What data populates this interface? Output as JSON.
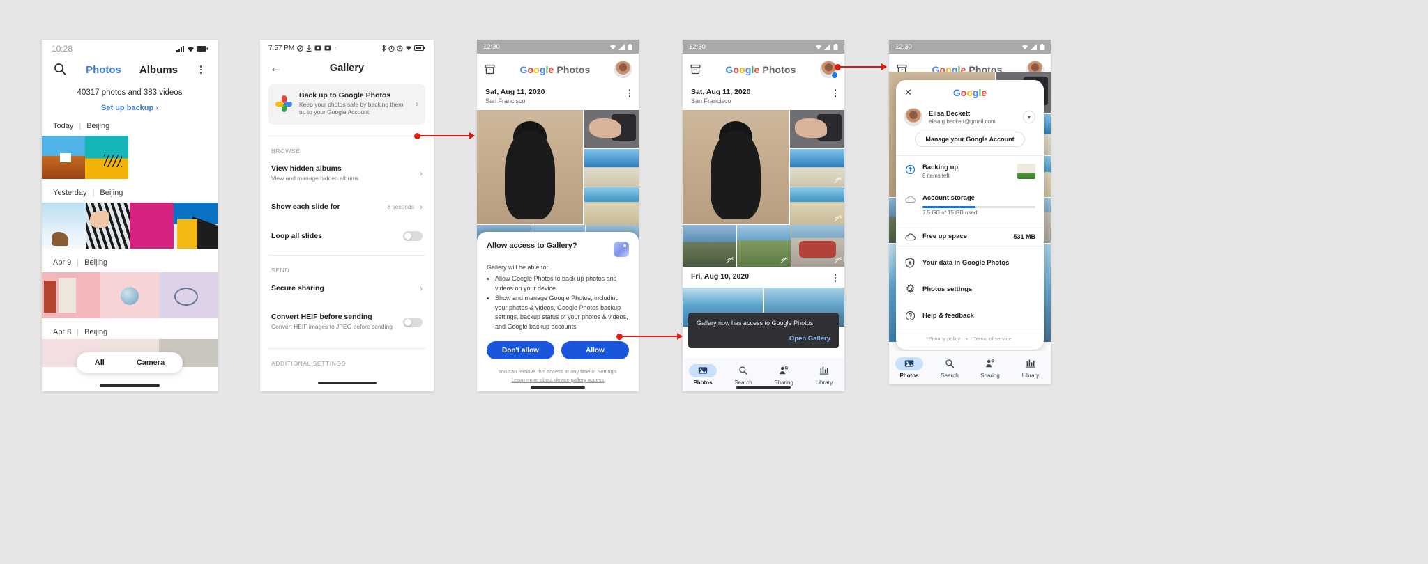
{
  "phone1": {
    "status_time": "10:28",
    "search_icon": "search-icon",
    "tabs": [
      {
        "label": "Photos",
        "active": true
      },
      {
        "label": "Albums",
        "active": false
      }
    ],
    "overflow_icon": "kebab-menu-icon",
    "count_text": "40317 photos and 383 videos",
    "setup_backup": "Set up backup",
    "setup_backup_chevron": "›",
    "sections": [
      {
        "date": "Today",
        "separator": "|",
        "place": "Beijing"
      },
      {
        "date": "Yesterday",
        "separator": "|",
        "place": "Beijing"
      },
      {
        "date": "Apr 9",
        "separator": "|",
        "place": "Beijing"
      },
      {
        "date": "Apr 8",
        "separator": "|",
        "place": "Beijing"
      }
    ],
    "bottom_tabs": [
      {
        "label": "All",
        "active": true
      },
      {
        "label": "Camera",
        "active": false
      }
    ]
  },
  "phone2": {
    "status_time": "7:57 PM",
    "status_icons": "dnd, download, screenshot, screen-record",
    "back_icon": "back-arrow-icon",
    "title": "Gallery",
    "backup_card": {
      "icon": "google-photos-icon",
      "title": "Back up to Google Photos",
      "subtitle": "Keep your photos safe by backing them up to your Google Account",
      "chevron": "›"
    },
    "sections": [
      {
        "header": "BROWSE",
        "rows": [
          {
            "title": "View hidden albums",
            "subtitle": "View and manage hidden albums",
            "value": "",
            "control": "chevron"
          },
          {
            "title": "Show each slide for",
            "subtitle": "",
            "value": "3 seconds",
            "control": "chevron"
          },
          {
            "title": "Loop all slides",
            "subtitle": "",
            "value": "",
            "control": "toggle-off"
          }
        ]
      },
      {
        "header": "SEND",
        "rows": [
          {
            "title": "Secure sharing",
            "subtitle": "",
            "value": "",
            "control": "chevron"
          },
          {
            "title": "Convert HEIF before sending",
            "subtitle": "Convert HEIF images to JPEG before sending",
            "value": "",
            "control": "toggle-off"
          }
        ]
      },
      {
        "header": "ADDITIONAL SETTINGS",
        "rows": []
      }
    ]
  },
  "phone3": {
    "status_time": "12:30",
    "archive_icon": "archive-icon",
    "brand": {
      "g1": "G",
      "o1": "o",
      "o2": "o",
      "g2": "g",
      "l": "l",
      "e": "e",
      "photos": "Photos"
    },
    "avatar_icon": "user-avatar",
    "date_header": "Sat, Aug 11, 2020",
    "location": "San Francisco",
    "overflow_icon": "kebab-menu-icon",
    "dialog": {
      "title": "Allow access to Gallery?",
      "app_icon": "gallery-app-icon",
      "lead": "Gallery will be able to:",
      "bullets": [
        "Allow Google Photos to back up photos and videos on your device",
        "Show and manage Google Photos, including your photos & videos, Google Photos backup settings, backup status of your photos & videos, and Google backup accounts"
      ],
      "deny_button": "Don't allow",
      "allow_button": "Allow",
      "footer_note": "You can remove this access at any time in Settings.",
      "footer_link": "Learn more about device gallery access"
    }
  },
  "phone4": {
    "status_time": "12:30",
    "archive_icon": "archive-icon",
    "brand": {
      "g1": "G",
      "o1": "o",
      "o2": "o",
      "g2": "g",
      "l": "l",
      "e": "e",
      "photos": "Photos"
    },
    "avatar_icon": "user-avatar",
    "date_header": "Sat, Aug 11, 2020",
    "location": "San Francisco",
    "date_header_2": "Fri, Aug 10, 2020",
    "overflow_icon": "kebab-menu-icon",
    "snackbar": {
      "message": "Gallery now has access to Google Photos",
      "action": "Open Gallery"
    },
    "bottom_nav": [
      {
        "label": "Photos",
        "icon": "photos-icon",
        "active": true
      },
      {
        "label": "Search",
        "icon": "search-icon",
        "active": false
      },
      {
        "label": "Sharing",
        "icon": "sharing-icon",
        "active": false
      },
      {
        "label": "Library",
        "icon": "library-icon",
        "active": false
      }
    ]
  },
  "phone5": {
    "status_time": "12:30",
    "archive_icon": "archive-icon",
    "brand": {
      "g1": "G",
      "o1": "o",
      "o2": "o",
      "g2": "g",
      "l": "l",
      "e": "e",
      "photos": "Photos"
    },
    "avatar_icon": "user-avatar",
    "account_panel": {
      "close_icon": "close-icon",
      "google_logo": {
        "g": "G",
        "o1": "o",
        "o2": "o",
        "g2": "g",
        "l": "l",
        "e": "e"
      },
      "user_name": "Elisa Beckett",
      "user_email": "elisa.g.beckett@gmail.com",
      "expand_icon": "chevron-down-icon",
      "manage_button": "Manage your Google Account",
      "backing_up": {
        "icon": "backup-upload-icon",
        "title": "Backing up",
        "subtitle": "8 items left",
        "thumb": "backup-thumbnail"
      },
      "storage": {
        "icon": "cloud-icon",
        "title": "Account storage",
        "usage_text": "7.5 GB of 15 GB used",
        "percent": 47
      },
      "rows": [
        {
          "icon": "cloud-free-icon",
          "title": "Free up space",
          "value": "531 MB"
        },
        {
          "icon": "shield-icon",
          "title": "Your data in Google Photos",
          "value": ""
        },
        {
          "icon": "gear-icon",
          "title": "Photos settings",
          "value": ""
        },
        {
          "icon": "help-icon",
          "title": "Help & feedback",
          "value": ""
        }
      ],
      "footer": {
        "privacy": "Privacy policy",
        "dot": "•",
        "terms": "Terms of service"
      }
    },
    "bottom_nav": [
      {
        "label": "Photos",
        "active": true
      },
      {
        "label": "Search",
        "active": false
      },
      {
        "label": "Sharing",
        "active": false
      },
      {
        "label": "Library",
        "active": false
      }
    ]
  },
  "annotations": {
    "accent_color": "#e01b12",
    "arrows": [
      {
        "name": "arrow-backup-to-photos"
      },
      {
        "name": "arrow-allow-to-snackbar"
      },
      {
        "name": "arrow-avatar-to-account"
      }
    ]
  }
}
